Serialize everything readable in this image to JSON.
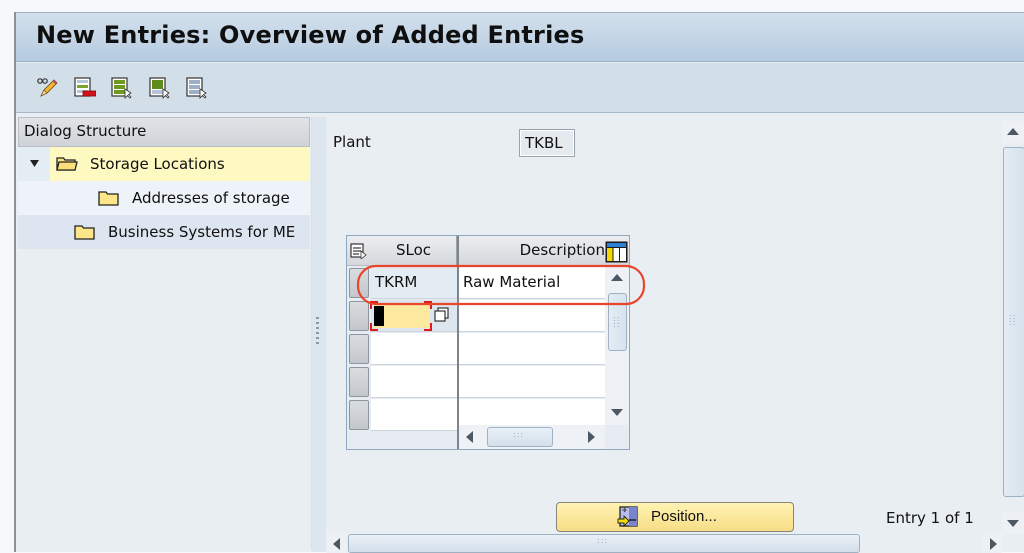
{
  "window": {
    "title": "New Entries: Overview of Added Entries"
  },
  "toolbar": {
    "buttons": [
      {
        "icon": "change-display-icon",
        "tooltip": ""
      },
      {
        "icon": "delete-row-icon",
        "tooltip": ""
      },
      {
        "icon": "select-all-icon",
        "tooltip": ""
      },
      {
        "icon": "select-block-icon",
        "tooltip": ""
      },
      {
        "icon": "deselect-all-icon",
        "tooltip": ""
      }
    ]
  },
  "dialog_structure": {
    "header": "Dialog Structure",
    "items": [
      {
        "label": "Storage Locations",
        "level": 0,
        "expanded": true,
        "selected": true,
        "icon": "open-folder-icon"
      },
      {
        "label": "Addresses of storage",
        "level": 1,
        "expanded": false,
        "selected": false,
        "icon": "folder-icon"
      },
      {
        "label": "Business Systems for ME",
        "level": 0,
        "expanded": false,
        "selected": false,
        "icon": "folder-icon"
      }
    ]
  },
  "main": {
    "plant_label": "Plant",
    "plant_value": "TKBL",
    "table": {
      "columns": [
        "SLoc",
        "Description"
      ],
      "rows": [
        {
          "sloc": "TKRM",
          "description": "Raw Material"
        },
        {
          "sloc": "",
          "description": ""
        },
        {
          "sloc": "",
          "description": ""
        },
        {
          "sloc": "",
          "description": ""
        },
        {
          "sloc": "",
          "description": ""
        }
      ]
    },
    "position_button": "Position...",
    "entry_info": "Entry 1 of 1"
  },
  "colors": {
    "title_bg": "#c4d6e7",
    "selection_highlight": "#fdf9c0",
    "input_active": "#fde9a0",
    "annotation_circle": "#e8452c",
    "button_yellow": "#f9e49a"
  }
}
